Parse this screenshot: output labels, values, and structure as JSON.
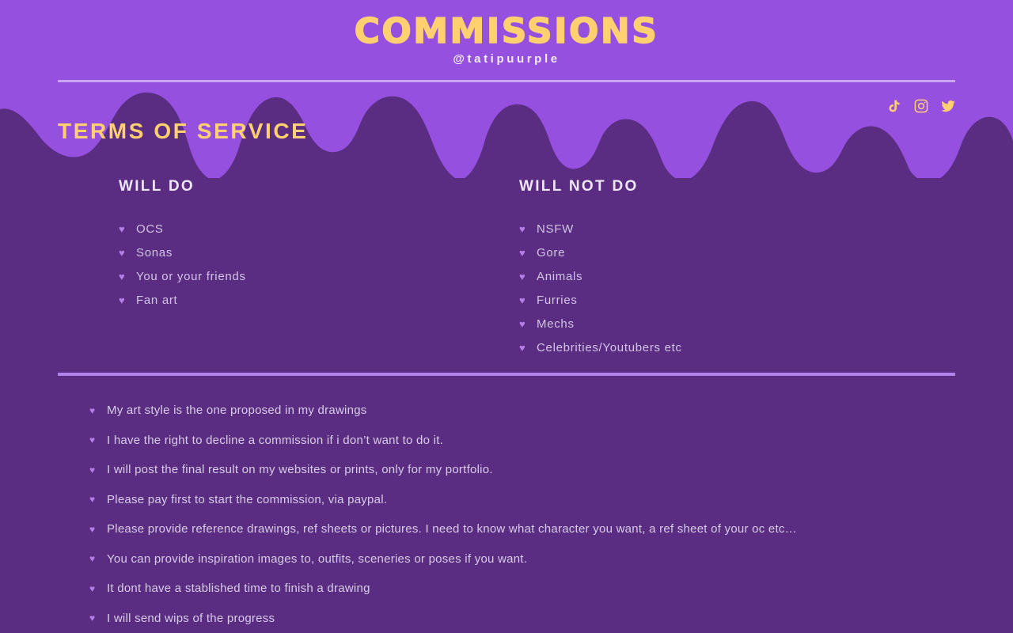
{
  "header": {
    "title": "COMMISSIONS",
    "handle": "@tatipuurple",
    "socials": [
      {
        "name": "tiktok-icon",
        "label": "TikTok"
      },
      {
        "name": "instagram-icon",
        "label": "Instagram"
      },
      {
        "name": "twitter-icon",
        "label": "Twitter"
      }
    ]
  },
  "section": {
    "heading": "TERMS OF SERVICE"
  },
  "columns": {
    "will_do": {
      "title": "WILL DO",
      "items": [
        "OCS",
        "Sonas",
        "You or your friends",
        "Fan art"
      ]
    },
    "will_not_do": {
      "title": "WILL NOT DO",
      "items": [
        "NSFW",
        "Gore",
        "Animals",
        "Furries",
        "Mechs",
        "Celebrities/Youtubers etc"
      ]
    }
  },
  "terms": [
    "My art style is the one proposed in my drawings",
    "I have the right to decline a commission if i don’t want to do it.",
    "I will post the final result on my websites or prints, only for my portfolio.",
    "Please pay first to start the commission, via paypal.",
    "Please provide reference drawings, ref sheets or pictures. I need to know what character you want, a ref sheet of your oc etc…",
    "You can provide inspiration images to, outfits, sceneries or poses if you want.",
    "It dont have a stablished time to finish a drawing",
    "I will send wips of the progress"
  ],
  "bullet": {
    "glyph": "♥"
  },
  "colors": {
    "light_purple": "#9650e0",
    "dark_purple": "#5a2d82",
    "accent_yellow": "#ffd070",
    "text_lavender": "#d8cce8",
    "divider": "#b183ec",
    "heart": "#b57fe8"
  }
}
